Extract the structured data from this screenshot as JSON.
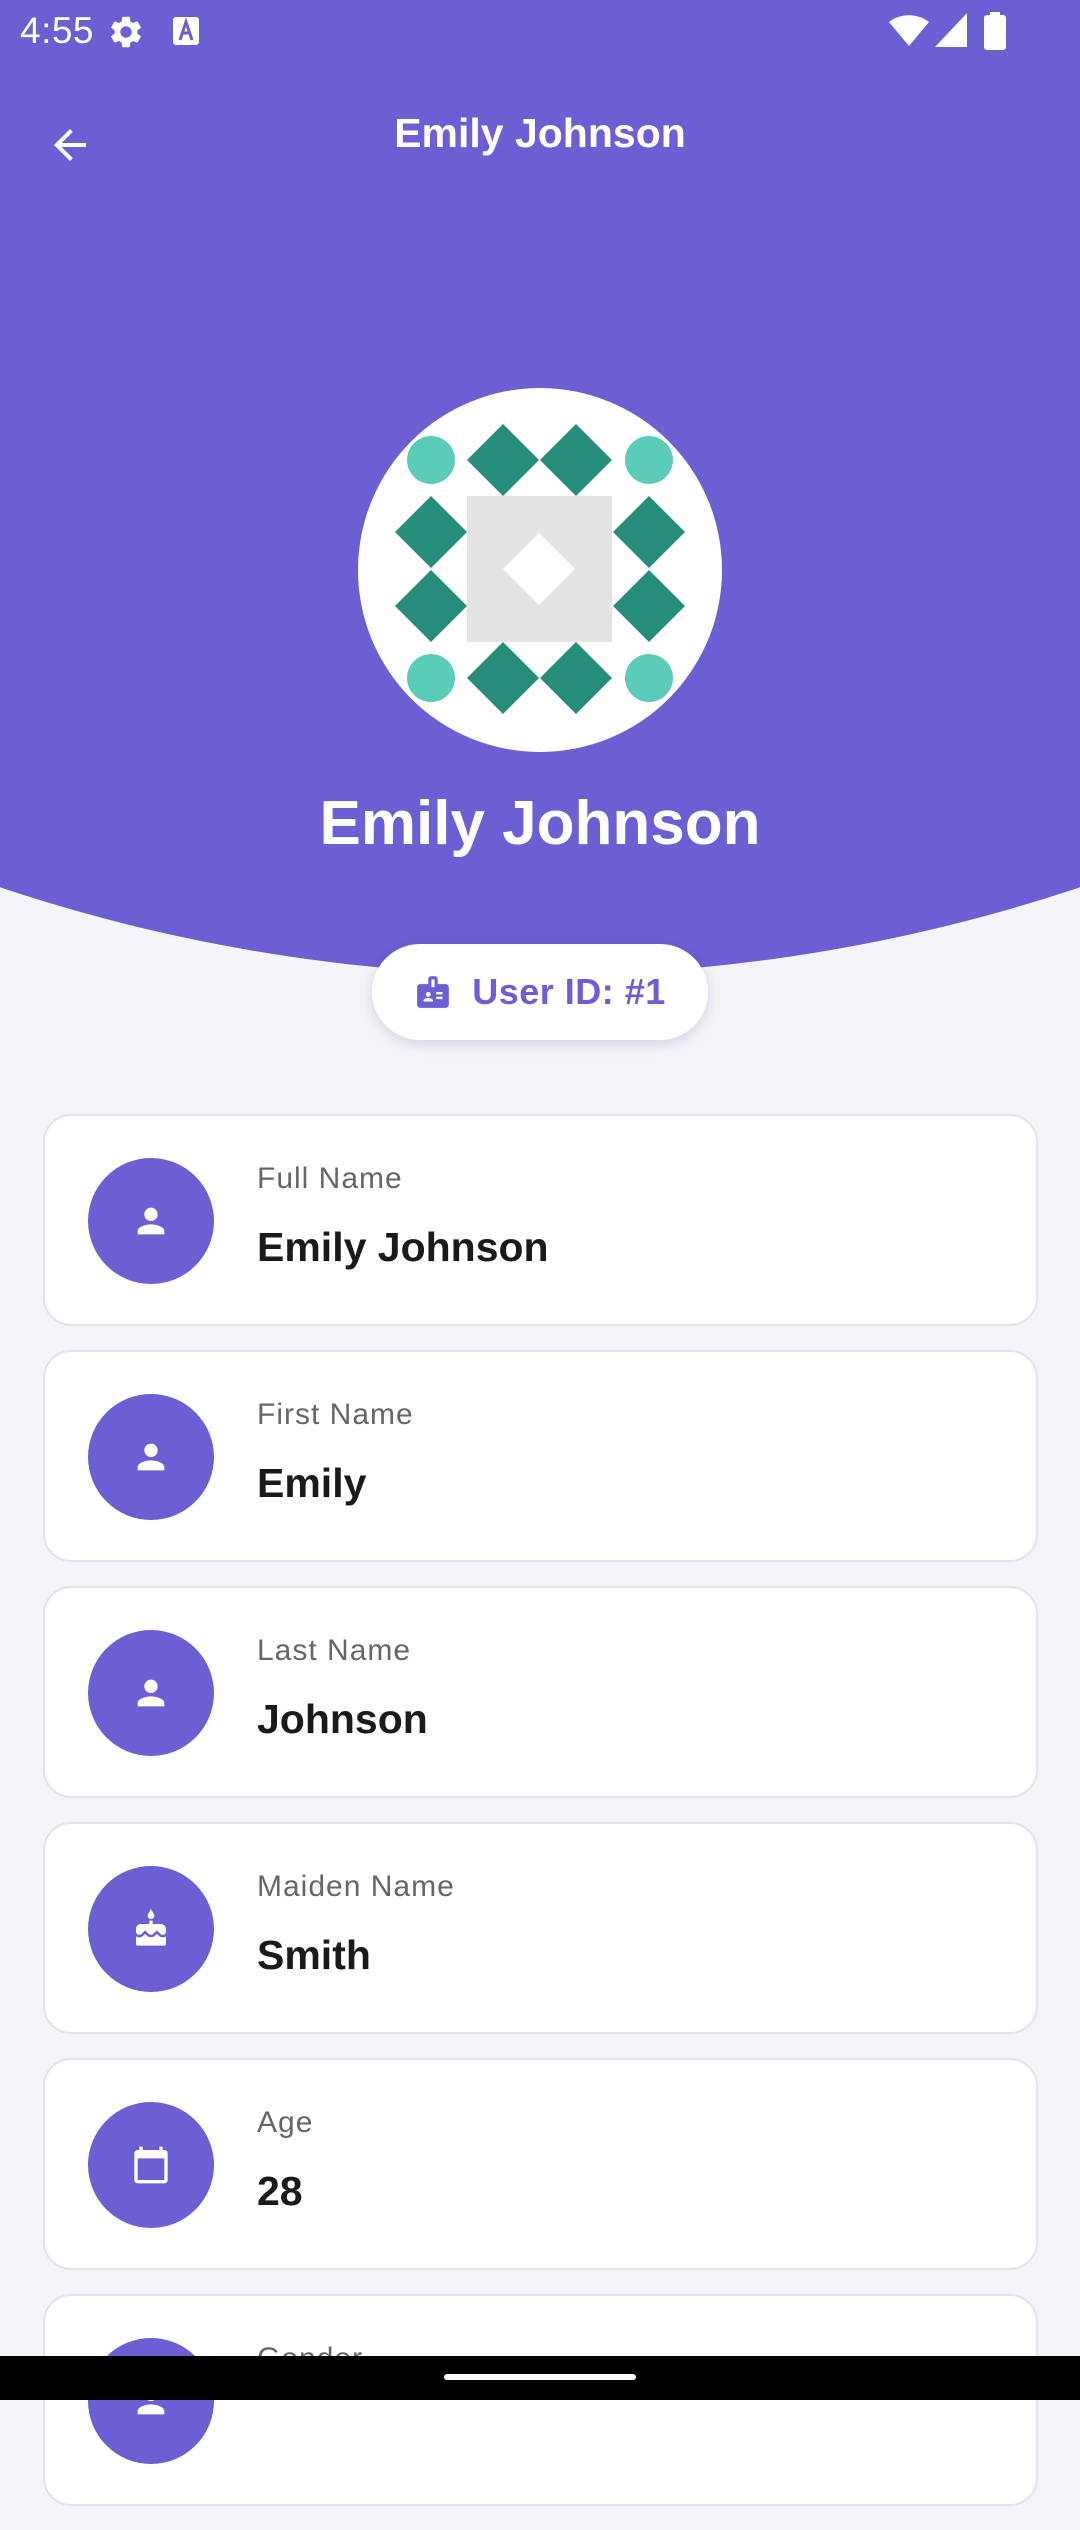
{
  "status_bar": {
    "time": "4:55",
    "icons": [
      "gear-icon",
      "text-a-icon",
      "wifi-icon",
      "signal-icon",
      "battery-icon"
    ]
  },
  "app_bar": {
    "title": "Emily Johnson",
    "back_icon": "arrow-left-icon"
  },
  "profile": {
    "name": "Emily Johnson",
    "avatar": "identicon",
    "id_chip": {
      "icon": "badge-icon",
      "label": "User ID: #1"
    }
  },
  "details": [
    {
      "label": "Full Name",
      "value": "Emily Johnson",
      "icon": "person-icon"
    },
    {
      "label": "First Name",
      "value": "Emily",
      "icon": "person-icon"
    },
    {
      "label": "Last Name",
      "value": "Johnson",
      "icon": "person-icon"
    },
    {
      "label": "Maiden Name",
      "value": "Smith",
      "icon": "cake-icon"
    },
    {
      "label": "Age",
      "value": "28",
      "icon": "calendar-icon"
    },
    {
      "label": "Gender",
      "value": "",
      "icon": "person-icon"
    }
  ],
  "colors": {
    "primary": "#6C5ED3",
    "background": "#F5F5F9",
    "card": "#FFFFFF",
    "card_border": "#E2E2EA",
    "label_text": "#666666",
    "value_text": "#1A1A1A",
    "avatar_dark": "#268D7A",
    "avatar_light": "#5BCCB9"
  }
}
